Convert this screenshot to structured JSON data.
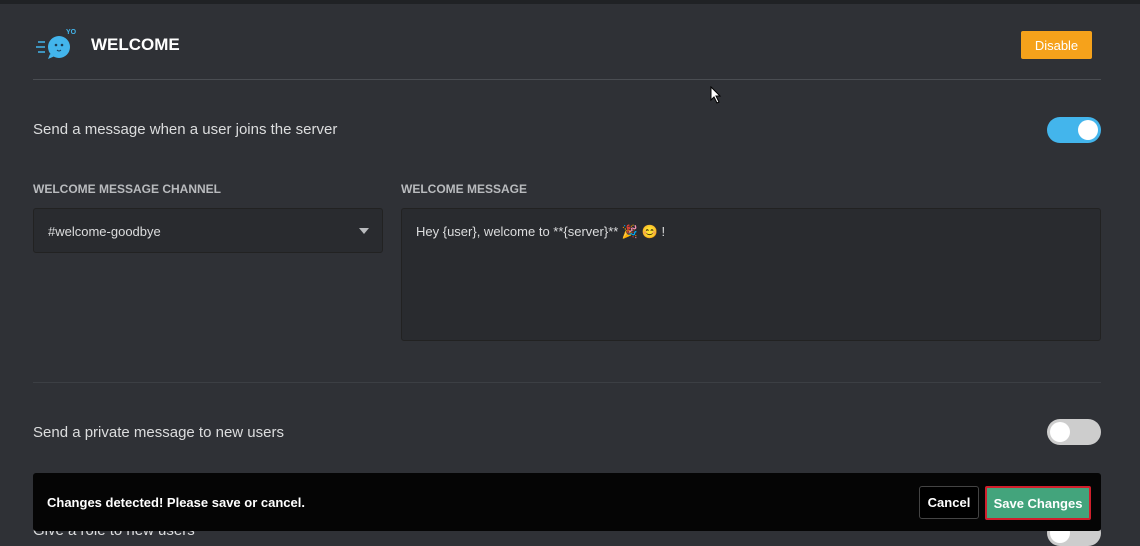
{
  "header": {
    "title": "WELCOME",
    "logo_text": "YO",
    "disable_label": "Disable",
    "logo_color": "#43b5ec"
  },
  "join_message": {
    "label": "Send a message when a user joins the server",
    "enabled": true
  },
  "channel": {
    "label": "WELCOME MESSAGE CHANNEL",
    "value": "#welcome-goodbye"
  },
  "message": {
    "label": "WELCOME MESSAGE",
    "value": "Hey {user}, welcome to **{server}** 🎉 😊 !"
  },
  "private_message": {
    "label": "Send a private message to new users",
    "enabled": false
  },
  "role": {
    "label": "Give a role to new users"
  },
  "save_bar": {
    "text": "Changes detected! Please save or cancel.",
    "cancel_label": "Cancel",
    "save_label": "Save Changes",
    "save_color": "#43a47c"
  }
}
